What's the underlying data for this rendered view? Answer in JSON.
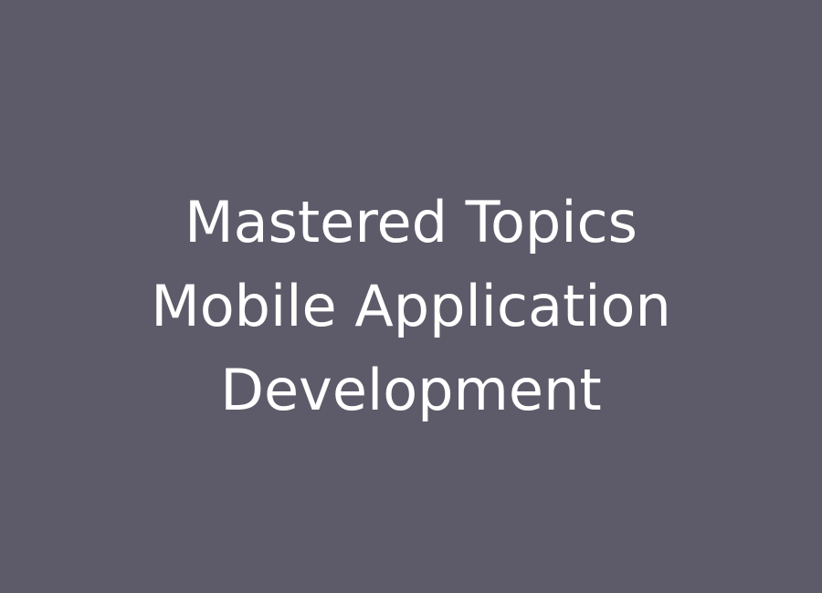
{
  "background_color": "#5d5b69",
  "text_color": "#ffffff",
  "headline": {
    "lines": [
      "Mastered Topics",
      "Mobile Application",
      "Development"
    ]
  }
}
